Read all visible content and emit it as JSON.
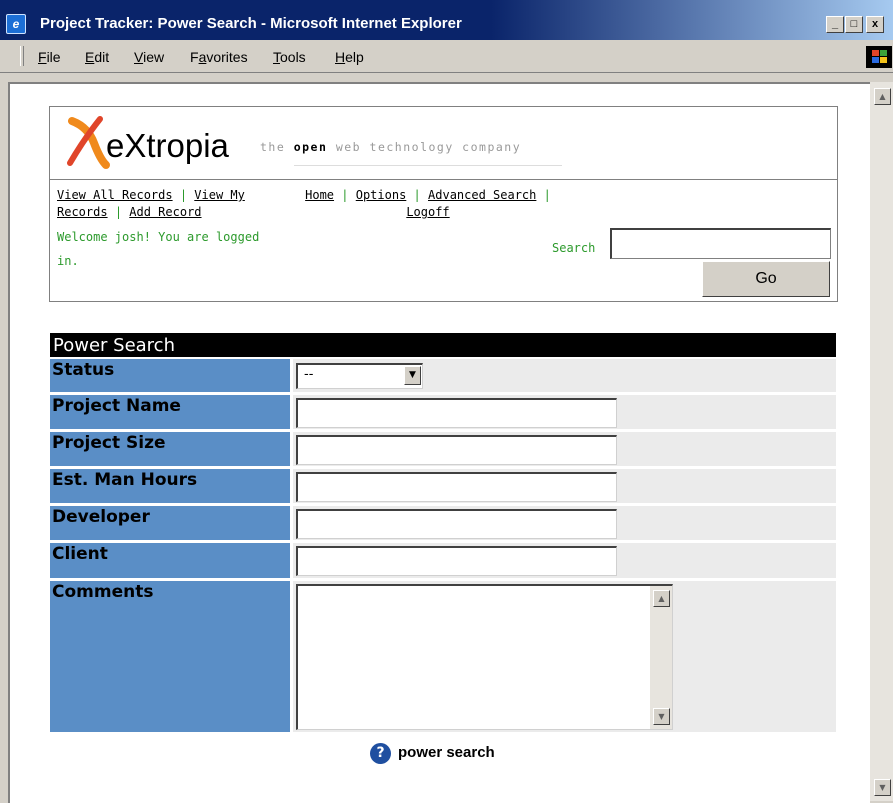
{
  "window": {
    "title": "Project Tracker: Power Search - Microsoft Internet Explorer",
    "controls": {
      "minimize": "_",
      "maximize": "□",
      "close": "x"
    }
  },
  "menubar": {
    "items": [
      {
        "label": "File",
        "mnemonic": "F",
        "rest": "ile"
      },
      {
        "label": "Edit",
        "mnemonic": "E",
        "rest": "dit"
      },
      {
        "label": "View",
        "mnemonic": "V",
        "rest": "iew"
      },
      {
        "label": "Favorites",
        "pre": "F",
        "mnemonic": "a",
        "rest": "vorites"
      },
      {
        "label": "Tools",
        "mnemonic": "T",
        "rest": "ools"
      },
      {
        "label": "Help",
        "mnemonic": "H",
        "rest": "elp"
      }
    ]
  },
  "header": {
    "logo_text": "eXtropia",
    "tagline_pre": "the ",
    "tagline_bold": "open",
    "tagline_post": " web technology company",
    "nav_left": {
      "view_all": "View All Records",
      "view_my": "View My Records",
      "add_record": "Add Record",
      "sep": "|"
    },
    "nav_right": {
      "home": "Home",
      "options": "Options",
      "advanced_search": "Advanced Search",
      "logoff": "Logoff",
      "sep": "|"
    },
    "welcome": "Welcome josh! You are logged in.",
    "search_label": "Search",
    "search_value": "",
    "go_label": "Go"
  },
  "power_search": {
    "title": "Power Search",
    "fields": {
      "status": {
        "label": "Status",
        "selected": "--"
      },
      "project_name": {
        "label": "Project Name",
        "value": ""
      },
      "project_size": {
        "label": "Project Size",
        "value": ""
      },
      "est_man_hours": {
        "label": "Est. Man Hours",
        "value": ""
      },
      "developer": {
        "label": "Developer",
        "value": ""
      },
      "client": {
        "label": "Client",
        "value": ""
      },
      "comments": {
        "label": "Comments",
        "value": ""
      }
    },
    "help_text": "power search",
    "help_icon": "question-mark"
  },
  "colors": {
    "titlebar": "#0a246a",
    "label_bg": "#5a8ec6",
    "cell_bg": "#ebebeb",
    "accent_green": "#2c9a2c",
    "logo_orange": "#f08a1c"
  }
}
